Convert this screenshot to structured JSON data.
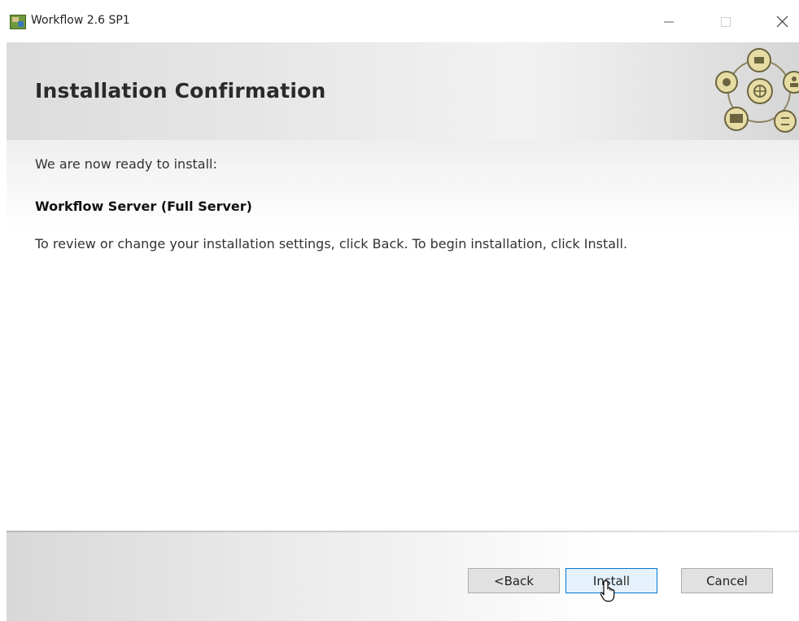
{
  "window": {
    "title": "Workflow 2.6 SP1",
    "controls": {
      "minimize": "minimize-icon",
      "maximize": "maximize-icon",
      "close": "close-icon"
    }
  },
  "header": {
    "title": "Installation Confirmation",
    "logo_icon": "workflow-logo-icon"
  },
  "content": {
    "ready_text": "We are now ready to install:",
    "product_name": "Workflow Server (Full Server)",
    "instructions": "To review or change your installation settings, click Back. To begin installation, click Install."
  },
  "buttons": {
    "back": "<Back",
    "install": "Install",
    "cancel": "Cancel"
  },
  "colors": {
    "install_border": "#0078d7",
    "install_fill": "#e5f1fb",
    "logo_fill": "#e6dca4",
    "logo_stroke": "#6b6440"
  }
}
